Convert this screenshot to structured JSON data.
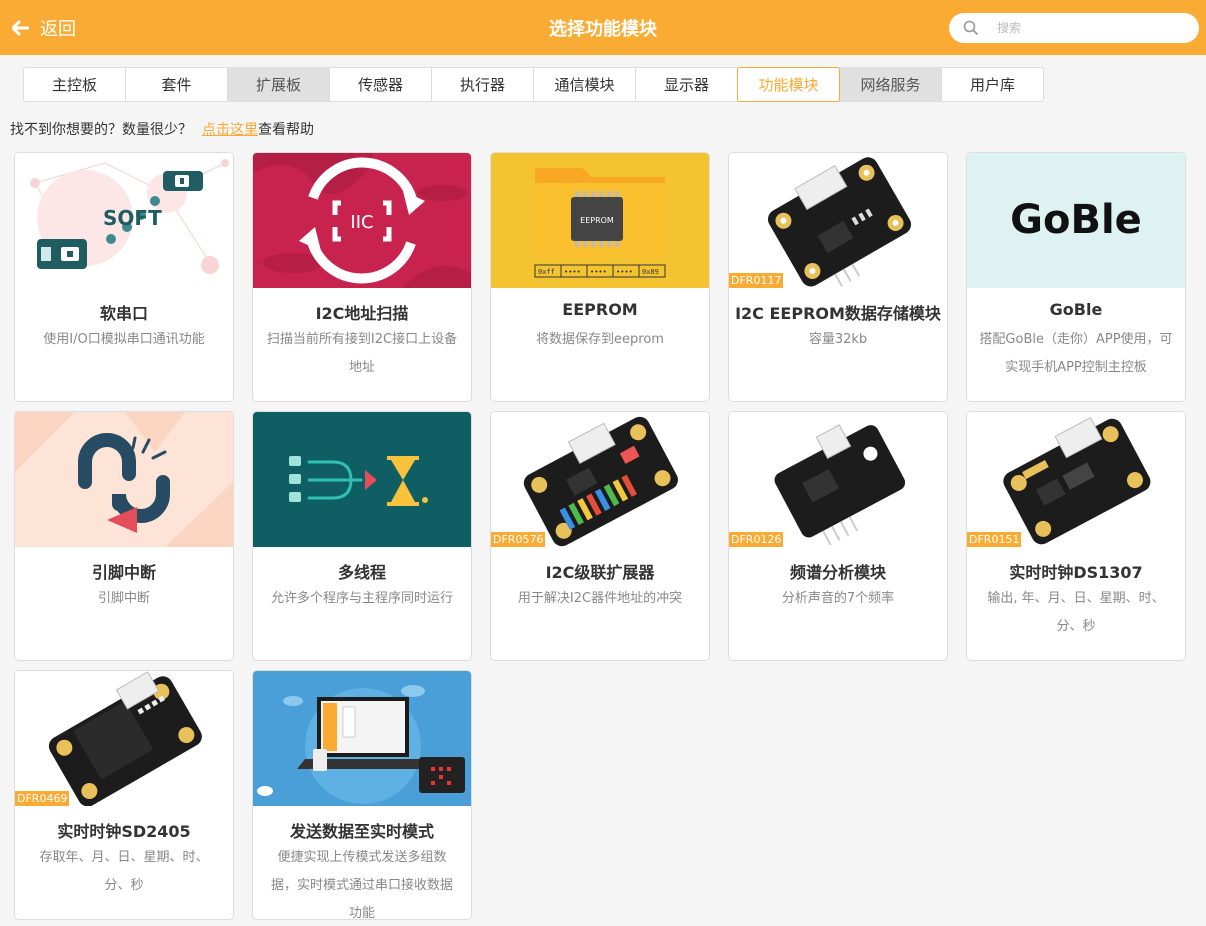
{
  "header": {
    "back_label": "返回",
    "title": "选择功能模块",
    "search_placeholder": "搜索"
  },
  "tabs": [
    {
      "label": "主控板",
      "state": "normal"
    },
    {
      "label": "套件",
      "state": "normal"
    },
    {
      "label": "扩展板",
      "state": "grey"
    },
    {
      "label": "传感器",
      "state": "normal"
    },
    {
      "label": "执行器",
      "state": "normal"
    },
    {
      "label": "通信模块",
      "state": "normal"
    },
    {
      "label": "显示器",
      "state": "normal"
    },
    {
      "label": "功能模块",
      "state": "active"
    },
    {
      "label": "网络服务",
      "state": "grey"
    },
    {
      "label": "用户库",
      "state": "normal"
    }
  ],
  "help": {
    "text": "找不到你想要的？数量很少？",
    "link": "点击这里",
    "suffix": "查看帮助"
  },
  "cards": [
    {
      "name": "软串口",
      "desc": "使用I/O口模拟串口通讯功能",
      "badge": ""
    },
    {
      "name": "I2C地址扫描",
      "desc": "扫描当前所有接到I2C接口上设备地址",
      "badge": ""
    },
    {
      "name": "EEPROM",
      "desc": "将数据保存到eeprom",
      "badge": ""
    },
    {
      "name": "I2C EEPROM数据存储模块",
      "desc": "容量32kb",
      "badge": "DFR0117"
    },
    {
      "name": "GoBle",
      "desc": "搭配GoBle（走你）APP使用，可实现手机APP控制主控板",
      "badge": ""
    },
    {
      "name": "引脚中断",
      "desc": "引脚中断",
      "badge": ""
    },
    {
      "name": "多线程",
      "desc": "允许多个程序与主程序同时运行",
      "badge": ""
    },
    {
      "name": "I2C级联扩展器",
      "desc": "用于解决I2C器件地址的冲突",
      "badge": "DFR0576"
    },
    {
      "name": "频谱分析模块",
      "desc": "分析声音的7个频率",
      "badge": "DFR0126"
    },
    {
      "name": "实时时钟DS1307",
      "desc": "输出, 年、月、日、星期、时、分、秒",
      "badge": "DFR0151"
    },
    {
      "name": "实时时钟SD2405",
      "desc": "存取年、月、日、星期、时、分、秒",
      "badge": "DFR0469"
    },
    {
      "name": "发送数据至实时模式",
      "desc": "便捷实现上传模式发送多组数据，实时模式通过串口接收数据功能",
      "badge": ""
    }
  ],
  "images": {
    "soft_text": "SOFT",
    "iic_text": "IIC",
    "eeprom_chip": "EEPROM",
    "eeprom_bytes": [
      "0xff",
      "••••",
      "••••",
      "••••",
      "0x89"
    ],
    "goble_text": "GoBle"
  },
  "colors": {
    "accent": "#f9ab33",
    "i2c_bg": "#c8234e",
    "eeprom_bg": "#f4c430",
    "goble_bg": "#dff2f2",
    "interrupt_bg": "#fde4d6",
    "thread_bg": "#0e5e63",
    "realtime_bg": "#4a9fd8"
  }
}
